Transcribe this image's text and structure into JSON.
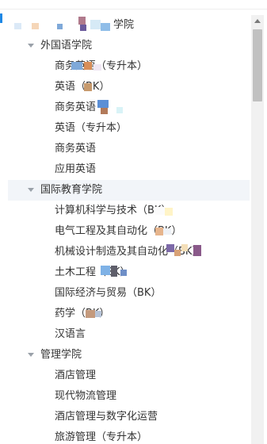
{
  "tree": {
    "root": {
      "label": "学院",
      "expanded": true
    },
    "groups": [
      {
        "label": "外国语学院",
        "expanded": true,
        "items": [
          "商务英语（专升本）",
          "英语（BK）",
          "商务英语",
          "英语（专升本）",
          "商务英语",
          "应用英语"
        ]
      },
      {
        "label": "国际教育学院",
        "expanded": true,
        "selected": true,
        "items": [
          "计算机科学与技术（BK）",
          "电气工程及其自动化（BK）",
          "机械设计制造及其自动化（BK）",
          "土木工程（BK）",
          "国际经济与贸易（BK）",
          "药学（BK）",
          "汉语言"
        ]
      },
      {
        "label": "管理学院",
        "expanded": true,
        "items": [
          "酒店管理",
          "现代物流管理",
          "酒店管理与数字化运营",
          "旅游管理（专升本）"
        ]
      }
    ]
  },
  "colors": {
    "selected_row": "#f2f5f9",
    "caret": "#9aa1a9",
    "scrollbar_track": "#f1f1f1",
    "scrollbar_thumb": "#c1c1c1",
    "accent": "#1e88e5"
  },
  "icons": {
    "expand_caret": "caret-down-icon",
    "scroll_up": "scroll-up-arrow-icon"
  }
}
